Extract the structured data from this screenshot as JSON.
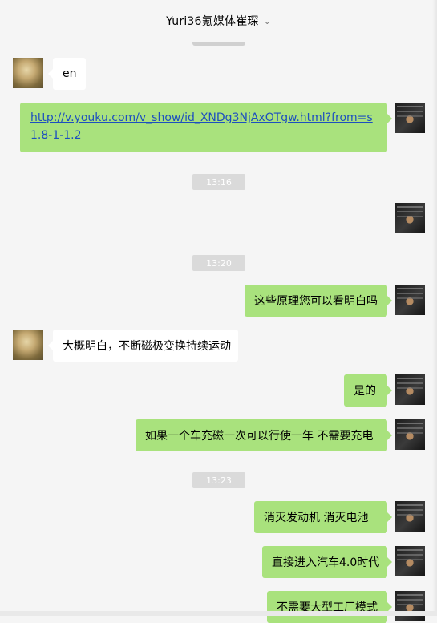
{
  "header": {
    "title": "Yuri36氪媒体崔琛"
  },
  "messages": [
    {
      "kind": "in",
      "text": "en"
    },
    {
      "kind": "out_link",
      "url": "http://v.youku.com/v_show/id_XNDg3NjAxOTgw.html?from=s1.8-1-1.2"
    },
    {
      "kind": "time",
      "text": "13:16"
    },
    {
      "kind": "time",
      "text": "13:20"
    },
    {
      "kind": "out",
      "text": "这些原理您可以看明白吗"
    },
    {
      "kind": "in",
      "text": "大概明白，不断磁极变换持续运动"
    },
    {
      "kind": "out",
      "text": "是的"
    },
    {
      "kind": "out",
      "text": "如果一个车充磁一次可以行使一年  不需要充电"
    },
    {
      "kind": "time",
      "text": "13:23"
    },
    {
      "kind": "out",
      "text": "消灭发动机  消灭电池"
    },
    {
      "kind": "out",
      "text": "直接进入汽车4.0时代"
    },
    {
      "kind": "out",
      "text": "不需要大型工厂模式"
    }
  ],
  "icons": {
    "header_dropdown": "chevron-down-icon"
  }
}
